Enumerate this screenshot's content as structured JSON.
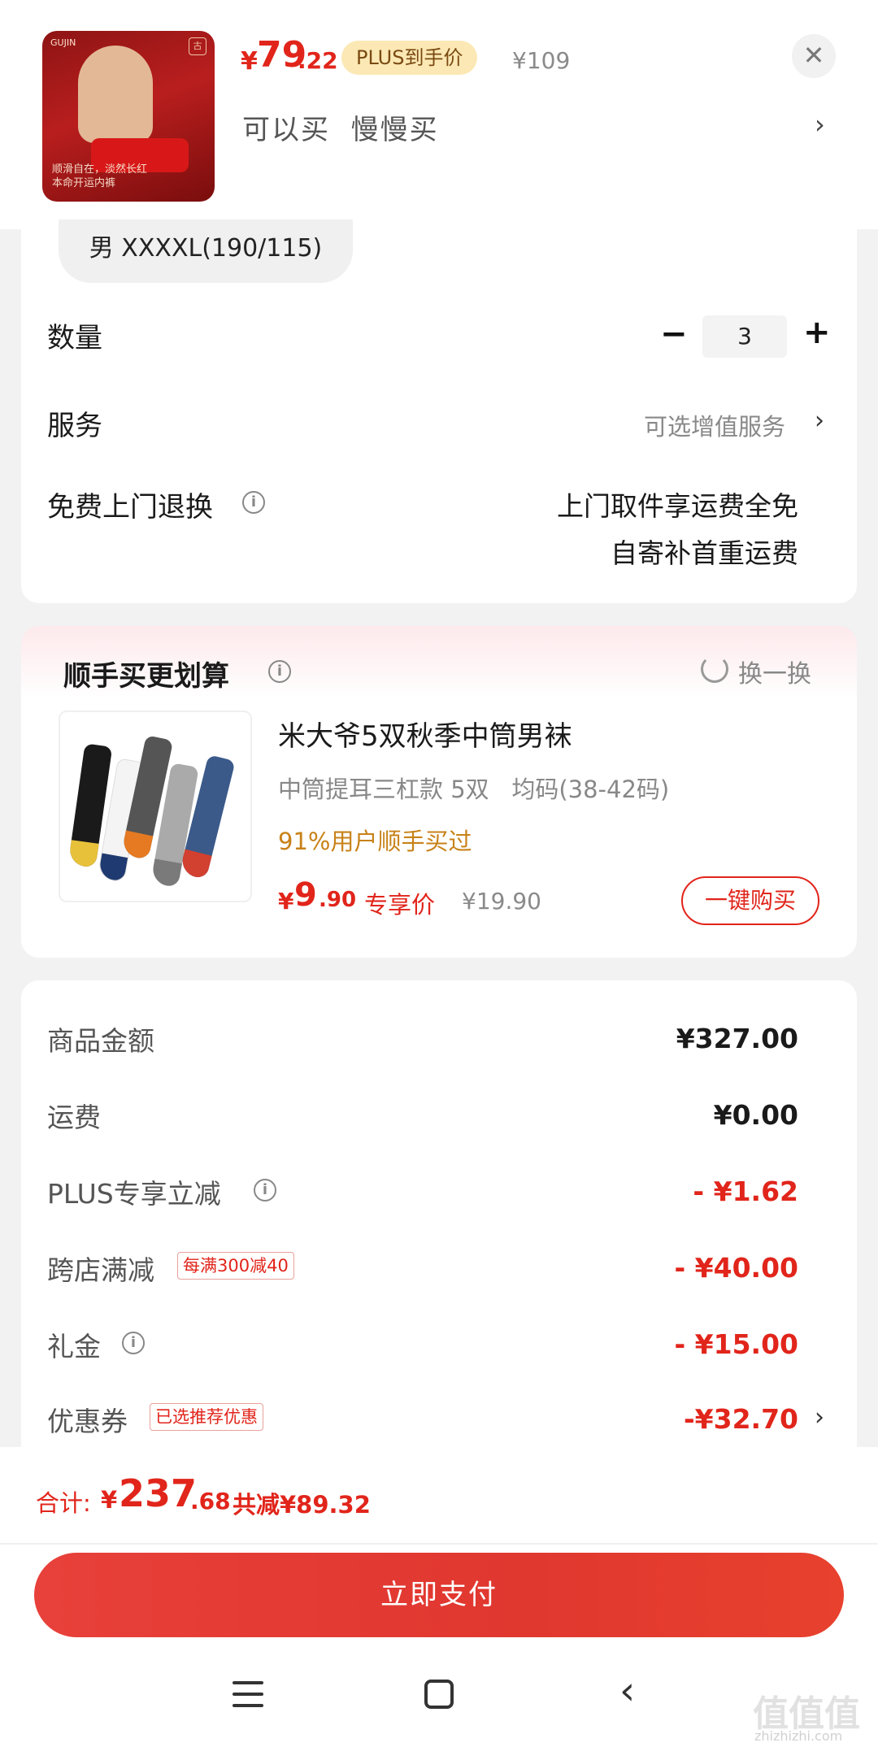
{
  "product": {
    "price_symbol": "¥",
    "price_int": "79",
    "price_dec": ".22",
    "plus_badge": "PLUS到手价",
    "original_price": "¥109",
    "slogan": "可以买  慢慢买",
    "thumb_caption": "顺滑自在，淡然长红\n本命开运内裤",
    "close_icon": "close-icon",
    "chevron_icon": "chevron-right-icon"
  },
  "spec": {
    "size": "男 XXXXL(190/115)",
    "quantity_label": "数量",
    "quantity": "3",
    "minus_symbol": "−",
    "plus_symbol": "+",
    "service_label": "服务",
    "service_value": "可选增值服务",
    "return_label": "免费上门退换",
    "return_line1": "上门取件享运费全免",
    "return_line2": "自寄补首重运费"
  },
  "recommend": {
    "title": "顺手买更划算",
    "swap_label": "换一换",
    "item_name": "米大爷5双秋季中筒男袜",
    "item_spec": "中筒提耳三杠款 5双   均码(38-42码)",
    "bought_text": "91%用户顺手买过",
    "price_symbol": "¥",
    "price_int": "9",
    "price_dec": ".90",
    "exclusive_label": "专享价",
    "original_price": "¥19.90",
    "buy_button": "一键购买"
  },
  "summary": {
    "rows": [
      {
        "label": "商品金额",
        "value": "¥327.00",
        "tag": ""
      },
      {
        "label": "运费",
        "value": "¥0.00",
        "tag": ""
      },
      {
        "label": "PLUS专享立减",
        "value": "- ¥1.62",
        "tag": ""
      },
      {
        "label": "跨店满减",
        "value": "- ¥40.00",
        "tag": "每满300减40"
      },
      {
        "label": "礼金",
        "value": "- ¥15.00",
        "tag": ""
      },
      {
        "label": "优惠券",
        "value": "-¥32.70",
        "tag": "已选推荐优惠"
      }
    ]
  },
  "footer": {
    "total_label": "合计:",
    "total_symbol": "¥",
    "total_int": "237",
    "total_dec": ".68",
    "total_saved": "共减¥89.32",
    "pay_button": "立即支付"
  },
  "watermark": {
    "text": "值值值",
    "url": "zhizhizhi.com"
  },
  "colors": {
    "accent_red": "#e1251b",
    "badge_gold": "#fbe8b4",
    "bought_orange": "#c88218"
  }
}
